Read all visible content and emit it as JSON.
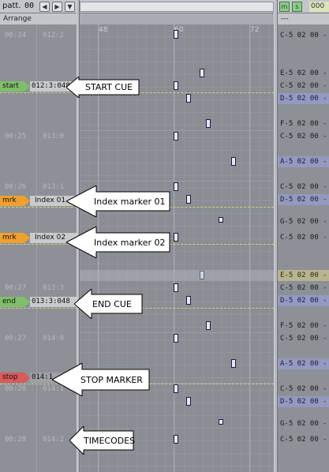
{
  "topbar": {
    "pattern_label": "patt.",
    "pattern_num": "00",
    "mode_m": "m",
    "mode_s": "s",
    "field_value": "000"
  },
  "arrange_label": "Arrange",
  "pattern_header": "---",
  "ruler_ticks": [
    "48",
    "60",
    "72"
  ],
  "timecodes": [
    {
      "left": "00:24",
      "right": "012:2"
    },
    {
      "left": "00:25",
      "right": "013:0"
    },
    {
      "left": "00:26",
      "right": "013:1"
    },
    {
      "left": "00:27",
      "right": "013:3"
    },
    {
      "left": "00:27",
      "right": "014:0"
    },
    {
      "left": "00:28",
      "right": "014:1"
    },
    {
      "left": "00:28",
      "right": "014:2"
    }
  ],
  "markers": [
    {
      "tag": "start",
      "value": "012:3:048",
      "callout": "START CUE"
    },
    {
      "tag": "mrk",
      "value": "Index 01",
      "callout": "Index marker 01"
    },
    {
      "tag": "mrk",
      "value": "Index 02",
      "callout": "Index marker 02"
    },
    {
      "tag": "end",
      "value": "013:3:048",
      "callout": "END CUE"
    },
    {
      "tag": "stop",
      "value": "014:1",
      "callout": "STOP MARKER"
    }
  ],
  "timecodes_callout": "TIMECODES",
  "pattern_rows": [
    "C-5 02 00 -",
    "E-5 02 00 -",
    "C-5 02 00 -",
    "D-5 02 00 -",
    "F-5 02 00 -",
    "C-5 02 00 -",
    "A-5 02 00 -",
    "C-5 02 00 -",
    "D-5 02 00 -",
    "G-5 02 00 -",
    "C-5 02 00 -",
    "E-5 02 00 -",
    "C-5 02 00 -",
    "D-5 02 00 -",
    "F-5 02 00 -",
    "C-5 02 00 -",
    "A-5 02 00 -",
    "C-5 02 00 -",
    "D-5 02 00 -",
    "G-5 02 00 -",
    "C-5 02 00 -"
  ],
  "colors": {
    "start": "#7fbf6a",
    "mrk": "#f0a030",
    "end": "#7fbf6a",
    "stop": "#d85a5a",
    "pattern_alt": "#9599c0"
  }
}
